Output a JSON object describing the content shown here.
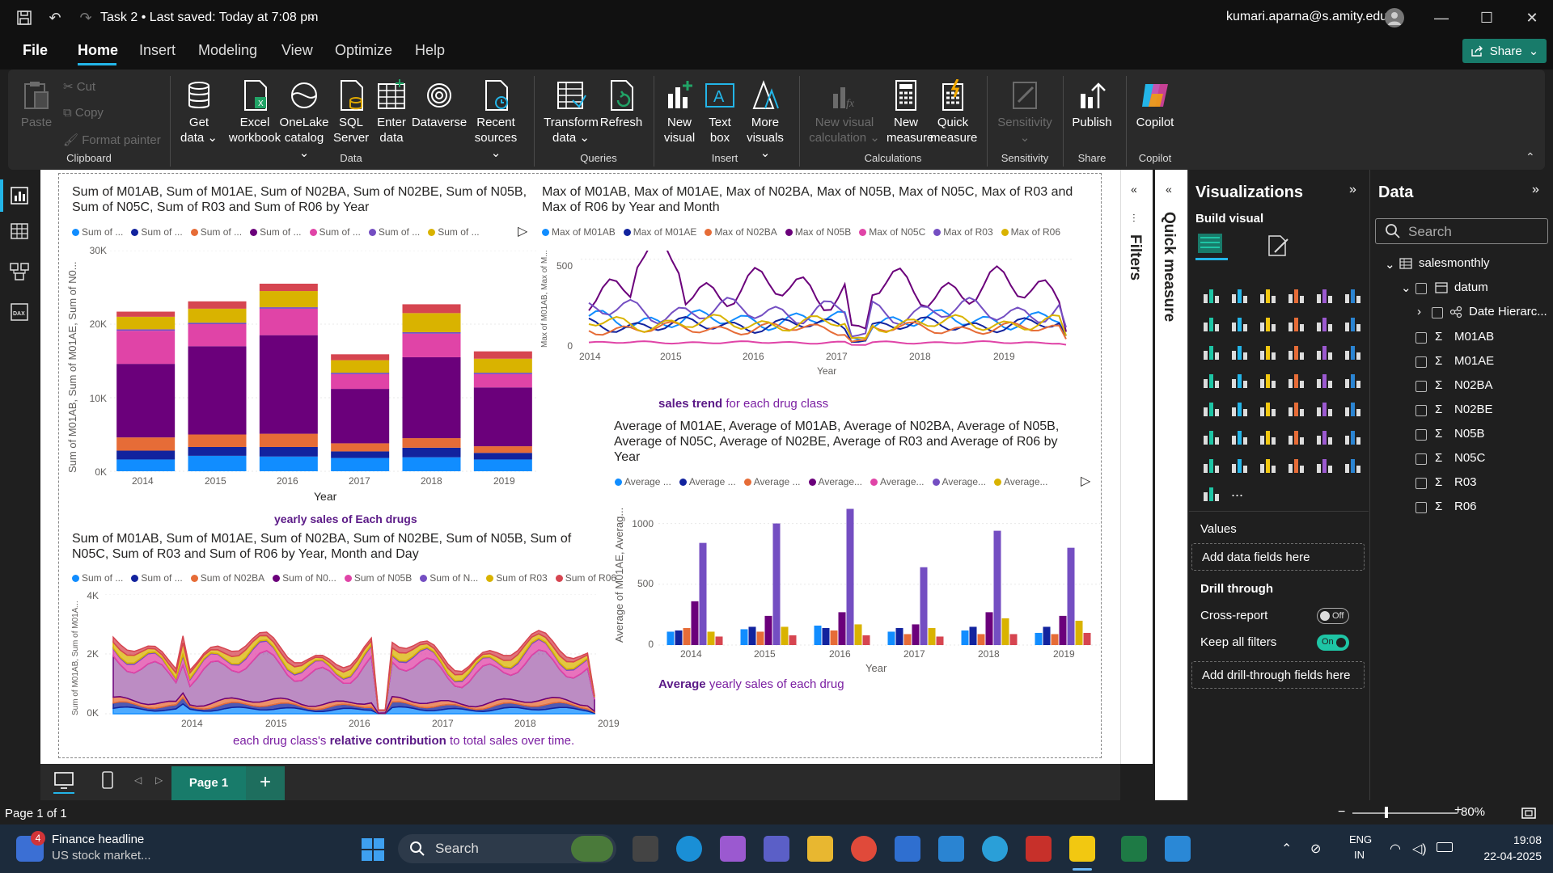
{
  "titlebar": {
    "doc_title": "Task 2 • Last saved: Today at 7:08 pm",
    "user_email": "kumari.aparna@s.amity.edu"
  },
  "menu": [
    "File",
    "Home",
    "Insert",
    "Modeling",
    "View",
    "Optimize",
    "Help"
  ],
  "share_label": "Share",
  "ribbon": {
    "clipboard": {
      "paste": "Paste",
      "cut": "Cut",
      "copy": "Copy",
      "format_painter": "Format painter",
      "group": "Clipboard"
    },
    "data": {
      "get_data": [
        "Get",
        "data ⌄"
      ],
      "excel": [
        "Excel",
        "workbook"
      ],
      "onelake": [
        "OneLake",
        "catalog ⌄"
      ],
      "sql": [
        "SQL",
        "Server"
      ],
      "enter": [
        "Enter",
        "data"
      ],
      "dataverse": "Dataverse",
      "recent": [
        "Recent",
        "sources ⌄"
      ],
      "group": "Data"
    },
    "queries": {
      "transform": [
        "Transform",
        "data ⌄"
      ],
      "refresh": "Refresh",
      "group": "Queries"
    },
    "insert": {
      "new_visual": [
        "New",
        "visual"
      ],
      "text_box": [
        "Text",
        "box"
      ],
      "more_visuals": [
        "More",
        "visuals ⌄"
      ],
      "group": "Insert"
    },
    "calculations": {
      "new_visual_calc": [
        "New visual",
        "calculation ⌄"
      ],
      "new_measure": [
        "New",
        "measure"
      ],
      "quick_measure": [
        "Quick",
        "measure"
      ],
      "group": "Calculations"
    },
    "sensitivity": {
      "label": [
        "Sensitivity",
        "⌄"
      ],
      "group": "Sensitivity"
    },
    "share": {
      "publish": "Publish",
      "group": "Share"
    },
    "copilot": {
      "label": "Copilot",
      "group": "Copilot"
    }
  },
  "visuals": {
    "v1": {
      "title": "Sum of M01AB, Sum of M01AE, Sum of N02BA, Sum of N02BE, Sum of N05B, Sum of N05C, Sum of R03 and Sum of R06 by Year",
      "legend": [
        "Sum of ...",
        "Sum of ...",
        "Sum of ...",
        "Sum of ...",
        "Sum of ...",
        "Sum of ...",
        "Sum of ..."
      ],
      "ylabel": "Sum of M01AB, Sum of M01AE, Sum of N0...",
      "xlabel": "Year",
      "yticks": [
        "30K",
        "20K",
        "10K",
        "0K"
      ],
      "subtitle": "yearly sales of Each drugs"
    },
    "v2": {
      "title": "Max of M01AB, Max of M01AE, Max of N02BA, Max of N05B, Max of N05C, Max of R03 and Max of R06 by Year and Month",
      "legend": [
        "Max of M01AB",
        "Max of M01AE",
        "Max of N02BA",
        "Max of N05B",
        "Max of N05C",
        "Max of R03",
        "Max of R06"
      ],
      "ylabel": "Max of M01AB, Max of M...",
      "xlabel": "Year",
      "yticks": [
        "500",
        "0"
      ],
      "subtitle_bold": "sales trend",
      "subtitle_rest": " for each drug class"
    },
    "v3": {
      "title": "Average of M01AE, Average of M01AB, Average of N02BA, Average of N05B, Average of N05C, Average of N02BE, Average of R03 and Average of R06 by Year",
      "legend": [
        "Average ...",
        "Average ...",
        "Average ...",
        "Average...",
        "Average...",
        "Average...",
        "Average..."
      ],
      "ylabel": "Average of M01AE, Averag...",
      "xlabel": "Year",
      "yticks": [
        "1000",
        "500",
        "0"
      ],
      "subtitle_bold": "Average",
      "subtitle_rest": " yearly sales of each drug"
    },
    "v4": {
      "title": "Sum of M01AB, Sum of M01AE, Sum of N02BA, Sum of N02BE, Sum of N05B, Sum of N05C, Sum of R03 and Sum of R06 by Year, Month and Day",
      "legend": [
        "Sum of ...",
        "Sum of ...",
        "Sum of N02BA",
        "Sum of N0...",
        "Sum of N05B",
        "Sum of N...",
        "Sum of R03",
        "Sum of R06"
      ],
      "ylabel": "Sum of M01AB, Sum of M01A...",
      "yticks": [
        "4K",
        "2K",
        "0K"
      ],
      "subtitle_pre": "each drug class's ",
      "subtitle_bold": "relative contribution",
      "subtitle_post": " to total sales over time."
    },
    "years": [
      "2014",
      "2015",
      "2016",
      "2017",
      "2018",
      "2019"
    ]
  },
  "chart_data": [
    {
      "type": "bar",
      "stacked": true,
      "categories": [
        "2014",
        "2015",
        "2016",
        "2017",
        "2018",
        "2019"
      ],
      "series": [
        {
          "color": "#118dff",
          "values": [
            1600,
            2100,
            2000,
            1800,
            1900,
            1600
          ]
        },
        {
          "color": "#12239e",
          "values": [
            1200,
            1200,
            1300,
            900,
            1300,
            900
          ]
        },
        {
          "color": "#e66c37",
          "values": [
            1800,
            1700,
            1800,
            1100,
            1300,
            900
          ]
        },
        {
          "color": "#6b007b",
          "values": [
            10000,
            12000,
            13400,
            7400,
            11000,
            8000
          ]
        },
        {
          "color": "#e044a7",
          "values": [
            4500,
            3000,
            3600,
            2000,
            3200,
            1800
          ]
        },
        {
          "color": "#744ec2",
          "values": [
            200,
            200,
            200,
            200,
            200,
            200
          ]
        },
        {
          "color": "#d9b300",
          "values": [
            1700,
            1900,
            2200,
            1700,
            2600,
            1900
          ]
        },
        {
          "color": "#d64550",
          "values": [
            700,
            1000,
            1000,
            800,
            1200,
            1000
          ]
        }
      ],
      "ylim": [
        0,
        30000
      ]
    },
    {
      "type": "line",
      "x_range": [
        "2014-01",
        "2019-10"
      ],
      "series_colors": [
        "#118dff",
        "#12239e",
        "#e66c37",
        "#6b007b",
        "#e044a7",
        "#744ec2",
        "#d9b300"
      ],
      "approx_levels": [
        150,
        120,
        100,
        330,
        20,
        200,
        130
      ],
      "ylim": [
        0,
        550
      ]
    },
    {
      "type": "bar",
      "categories": [
        "2014",
        "2015",
        "2016",
        "2017",
        "2018",
        "2019"
      ],
      "series": [
        {
          "color": "#118dff",
          "values": [
            110,
            130,
            160,
            110,
            120,
            100
          ]
        },
        {
          "color": "#12239e",
          "values": [
            120,
            150,
            140,
            140,
            150,
            150
          ]
        },
        {
          "color": "#e66c37",
          "values": [
            140,
            110,
            120,
            90,
            90,
            90
          ]
        },
        {
          "color": "#6b007b",
          "values": [
            360,
            240,
            270,
            170,
            270,
            240
          ]
        },
        {
          "color": "#744ec2",
          "values": [
            840,
            1000,
            1120,
            640,
            940,
            800
          ]
        },
        {
          "color": "#d9b300",
          "values": [
            110,
            150,
            170,
            140,
            220,
            200
          ]
        },
        {
          "color": "#d64550",
          "values": [
            70,
            80,
            80,
            70,
            90,
            100
          ]
        }
      ],
      "ylim": [
        0,
        1150
      ]
    },
    {
      "type": "area",
      "stacked": true,
      "x_range": [
        "2014-01",
        "2019-10"
      ],
      "series_colors": [
        "#118dff",
        "#12239e",
        "#e66c37",
        "#6b007b",
        "#e044a7",
        "#744ec2",
        "#d9b300",
        "#d64550"
      ],
      "ylim": [
        0,
        4000
      ]
    }
  ],
  "filters_label": "Filters",
  "quick_measure_label": "Quick measure",
  "visualizations": {
    "title": "Visualizations",
    "build_visual": "Build visual",
    "values_label": "Values",
    "add_data_fields": "Add data fields here",
    "drill_through": "Drill through",
    "cross_report": "Cross-report",
    "cross_report_state": "Off",
    "keep_all_filters": "Keep all filters",
    "keep_all_filters_state": "On",
    "add_drill_fields": "Add drill-through fields here",
    "more": "..."
  },
  "data_pane": {
    "title": "Data",
    "search_placeholder": "Search",
    "table": "salesmonthly",
    "folder": "datum",
    "hierarchy": "Date Hierarc...",
    "fields": [
      "M01AB",
      "M01AE",
      "N02BA",
      "N02BE",
      "N05B",
      "N05C",
      "R03",
      "R06"
    ]
  },
  "page_tab": "Page 1",
  "status": {
    "page_of": "Page 1 of 1",
    "zoom": "80%"
  },
  "taskbar": {
    "news_badge": "4",
    "news_title": "Finance headline",
    "news_sub": "US stock market...",
    "search": "Search",
    "lang1": "ENG",
    "lang2": "IN",
    "time": "19:08",
    "date": "22-04-2025"
  }
}
